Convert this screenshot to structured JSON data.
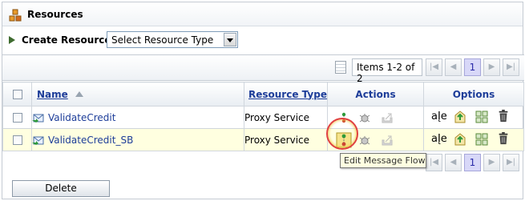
{
  "header": {
    "title": "Resources",
    "icon": "resources-icon"
  },
  "create_resource": {
    "label": "Create Resource:",
    "select_value": "Select Resource Type"
  },
  "pager": {
    "items_text": "Items 1-2 of 2",
    "current_page": "1"
  },
  "table": {
    "columns": {
      "name": "Name",
      "resource_type": "Resource Type",
      "actions": "Actions",
      "options": "Options"
    },
    "rows": [
      {
        "name": "ValidateCredit",
        "resource_type": "Proxy Service"
      },
      {
        "name": "ValidateCredit_SB",
        "resource_type": "Proxy Service"
      }
    ],
    "option_labels": {
      "rename": "aĮe"
    }
  },
  "tooltip": {
    "text": "Edit Message Flow"
  },
  "footer": {
    "delete_label": "Delete"
  },
  "colors": {
    "link": "#1d3d99",
    "row_highlight": "#ffffe0",
    "accent_ring": "#e04040"
  }
}
